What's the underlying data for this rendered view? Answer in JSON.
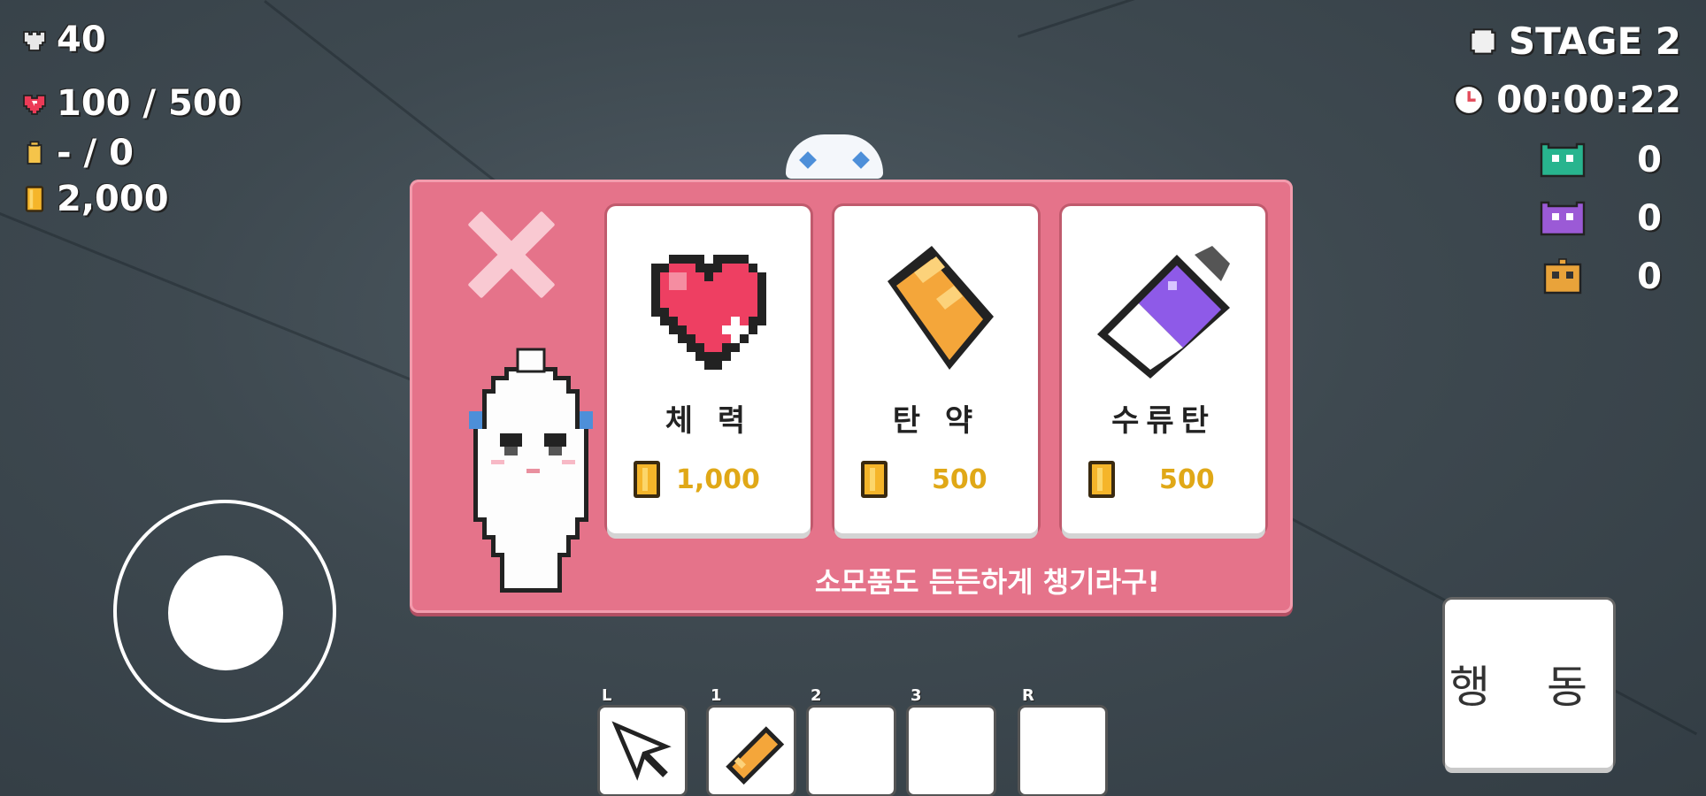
{
  "hud_left": {
    "kills": "40",
    "health": "100 / 500",
    "ammo": "- / 0",
    "gold": "2,000"
  },
  "hud_right": {
    "stage": "STAGE 2",
    "timer": "00:00:22",
    "enemies": [
      {
        "icon": "green-monster-icon",
        "count": "0",
        "color": "#28b48e"
      },
      {
        "icon": "purple-monster-icon",
        "count": "0",
        "color": "#9b5ad6"
      },
      {
        "icon": "orange-robot-icon",
        "count": "0",
        "color": "#e9a33a"
      }
    ]
  },
  "shop": {
    "items": [
      {
        "name": "체 력",
        "price": "1,000",
        "icon": "heart-icon"
      },
      {
        "name": "탄 약",
        "price": "500",
        "icon": "ammo-icon"
      },
      {
        "name": "수류탄",
        "price": "500",
        "icon": "grenade-icon"
      }
    ],
    "message": "소모품도 든든하게 챙기라구!"
  },
  "action_button": "행 동",
  "hotbar": {
    "slots": [
      {
        "key": "L",
        "item": "cursor-icon"
      },
      {
        "key": "1",
        "item": "bullet-icon"
      },
      {
        "key": "2",
        "item": ""
      },
      {
        "key": "3",
        "item": ""
      },
      {
        "key": "R",
        "item": ""
      }
    ]
  },
  "colors": {
    "panel": "#e5738a",
    "gold": "#e0a817",
    "background": "#3e4950"
  }
}
